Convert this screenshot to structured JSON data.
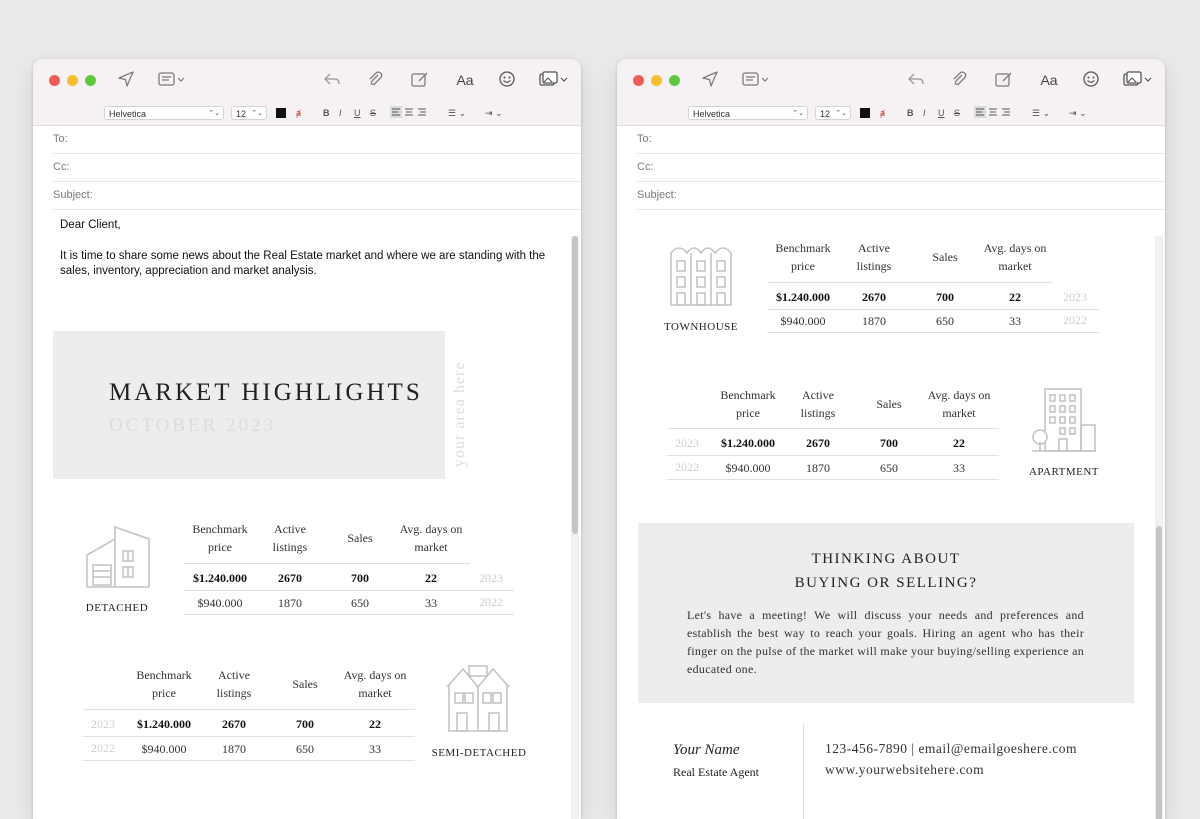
{
  "toolbar": {
    "font_name": "Helvetica",
    "font_size": "12",
    "aa_label": "Aa",
    "bold": "B",
    "italic": "I",
    "underline": "U",
    "strike": "S",
    "font_color": "#111111"
  },
  "fields": {
    "to": "To:",
    "cc": "Cc:",
    "subject": "Subject:"
  },
  "email": {
    "greeting": "Dear Client,",
    "intro": "It is time to share some news about the Real Estate market and where we are standing with the sales, inventory, appreciation and market analysis."
  },
  "highlights": {
    "title": "MARKET HIGHLIGHTS",
    "subtitle": "OCTOBER 2023",
    "area": "your area here"
  },
  "table_headers": {
    "price": [
      "Benchmark",
      "price"
    ],
    "listings": [
      "Active",
      "listings"
    ],
    "sales": "Sales",
    "days": [
      "Avg. days on",
      "market"
    ]
  },
  "property_types": [
    {
      "name": "DETACHED",
      "rows": [
        {
          "year": "2023",
          "price": "$1.240.000",
          "listings": "2670",
          "sales": "700",
          "days": "22"
        },
        {
          "year": "2022",
          "price": "$940.000",
          "listings": "1870",
          "sales": "650",
          "days": "33"
        }
      ]
    },
    {
      "name": "SEMI-DETACHED",
      "rows": [
        {
          "year": "2023",
          "price": "$1.240.000",
          "listings": "2670",
          "sales": "700",
          "days": "22"
        },
        {
          "year": "2022",
          "price": "$940.000",
          "listings": "1870",
          "sales": "650",
          "days": "33"
        }
      ]
    },
    {
      "name": "TOWNHOUSE",
      "rows": [
        {
          "year": "2023",
          "price": "$1.240.000",
          "listings": "2670",
          "sales": "700",
          "days": "22"
        },
        {
          "year": "2022",
          "price": "$940.000",
          "listings": "1870",
          "sales": "650",
          "days": "33"
        }
      ]
    },
    {
      "name": "APARTMENT",
      "rows": [
        {
          "year": "2023",
          "price": "$1.240.000",
          "listings": "2670",
          "sales": "700",
          "days": "22"
        },
        {
          "year": "2022",
          "price": "$940.000",
          "listings": "1870",
          "sales": "650",
          "days": "33"
        }
      ]
    }
  ],
  "cta": {
    "title_line1": "THINKING ABOUT",
    "title_line2": "BUYING OR SELLING?",
    "text": "Let's have a meeting! We will discuss your needs and preferences and establish the best way to reach your goals. Hiring an agent who has their finger on the pulse of the market will make your buying/selling experience an educated one."
  },
  "signature": {
    "name": "Your Name",
    "role": "Real Estate Agent",
    "contact": "123-456-7890 | email@emailgoeshere.com",
    "website": "www.yourwebsitehere.com"
  },
  "colors": {
    "window_chrome": "#f6f1f2",
    "panel_gray": "#ededed",
    "traffic_red": "#ee5e57",
    "traffic_yellow": "#f5bd2f",
    "traffic_green": "#5fc640"
  }
}
